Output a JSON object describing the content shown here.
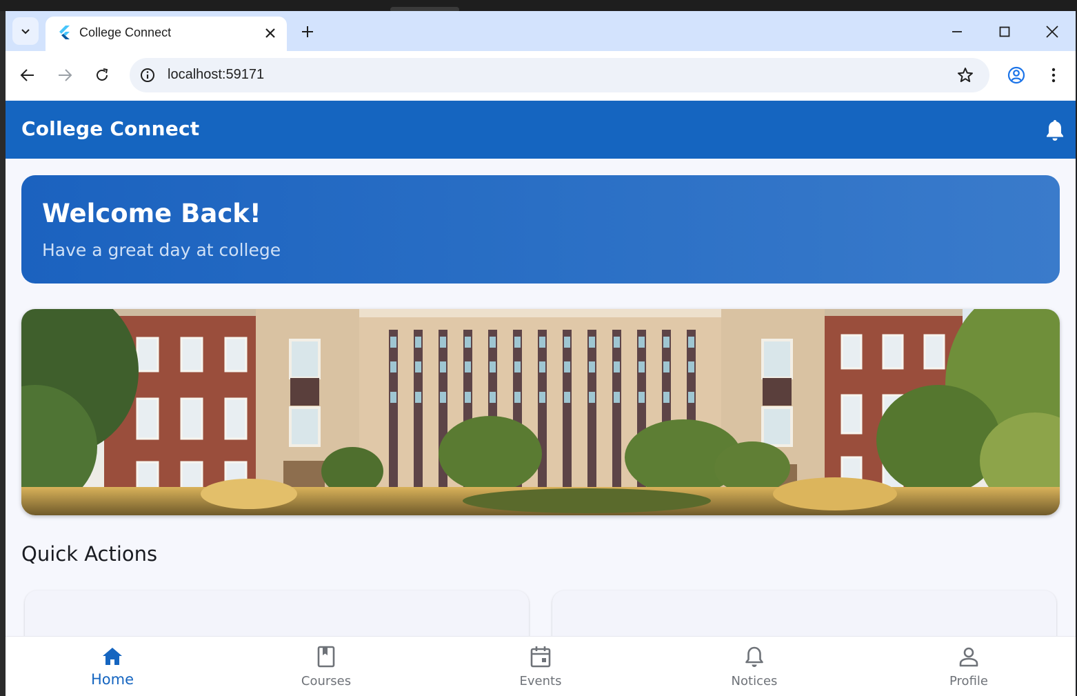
{
  "browser": {
    "tab_title": "College Connect",
    "url": "localhost:59171"
  },
  "app": {
    "title": "College Connect",
    "welcome": {
      "heading": "Welcome Back!",
      "subtitle": "Have a great day at college"
    },
    "quick_actions_title": "Quick Actions",
    "bottom_nav": [
      {
        "label": "Home",
        "icon": "home-icon",
        "active": true
      },
      {
        "label": "Courses",
        "icon": "book-icon",
        "active": false
      },
      {
        "label": "Events",
        "icon": "calendar-icon",
        "active": false
      },
      {
        "label": "Notices",
        "icon": "bell-icon",
        "active": false
      },
      {
        "label": "Profile",
        "icon": "person-icon",
        "active": false
      }
    ]
  },
  "colors": {
    "primary": "#1565c0",
    "tab_strip": "#d3e3fd",
    "inactive": "#6e7278"
  }
}
